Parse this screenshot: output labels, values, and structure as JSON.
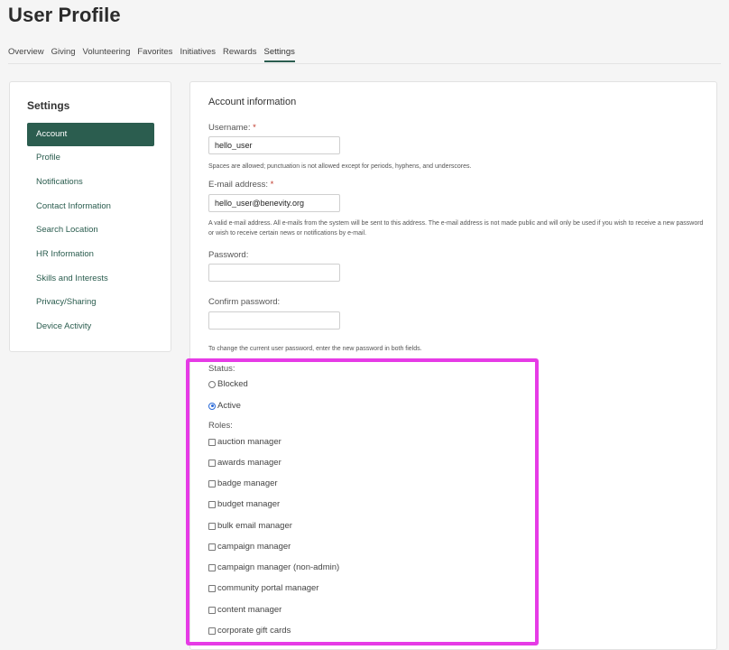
{
  "page": {
    "title": "User Profile"
  },
  "tabs": [
    "Overview",
    "Giving",
    "Volunteering",
    "Favorites",
    "Initiatives",
    "Rewards",
    "Settings"
  ],
  "active_tab": "Settings",
  "sidebar": {
    "title": "Settings",
    "items": [
      "Account",
      "Profile",
      "Notifications",
      "Contact Information",
      "Search Location",
      "HR Information",
      "Skills and Interests",
      "Privacy/Sharing",
      "Device Activity"
    ],
    "active": "Account"
  },
  "account": {
    "section_title": "Account information",
    "username": {
      "label": "Username:",
      "required_mark": "*",
      "value": "hello_user",
      "help": "Spaces are allowed; punctuation is not allowed except for periods, hyphens, and underscores."
    },
    "email": {
      "label": "E-mail address:",
      "required_mark": "*",
      "value": "hello_user@benevity.org",
      "help": "A valid e-mail address. All e-mails from the system will be sent to this address. The e-mail address is not made public and will only be used if you wish to receive a new password or wish to receive certain news or notifications by e-mail."
    },
    "password": {
      "label": "Password:",
      "value": ""
    },
    "confirm_password": {
      "label": "Confirm password:",
      "value": ""
    },
    "password_help": "To change the current user password, enter the new password in both fields.",
    "status": {
      "label": "Status:",
      "options": [
        "Blocked",
        "Active"
      ],
      "selected": "Active"
    },
    "roles": {
      "label": "Roles:",
      "items": [
        "auction manager",
        "awards manager",
        "badge manager",
        "budget manager",
        "bulk email manager",
        "campaign manager",
        "campaign manager (non-admin)",
        "community portal manager",
        "content manager",
        "corporate gift cards"
      ]
    }
  },
  "colors": {
    "accent": "#2b5d4f",
    "highlight": "#e63be6",
    "radio_selected": "#2a6ad8",
    "required": "#c0392b"
  }
}
